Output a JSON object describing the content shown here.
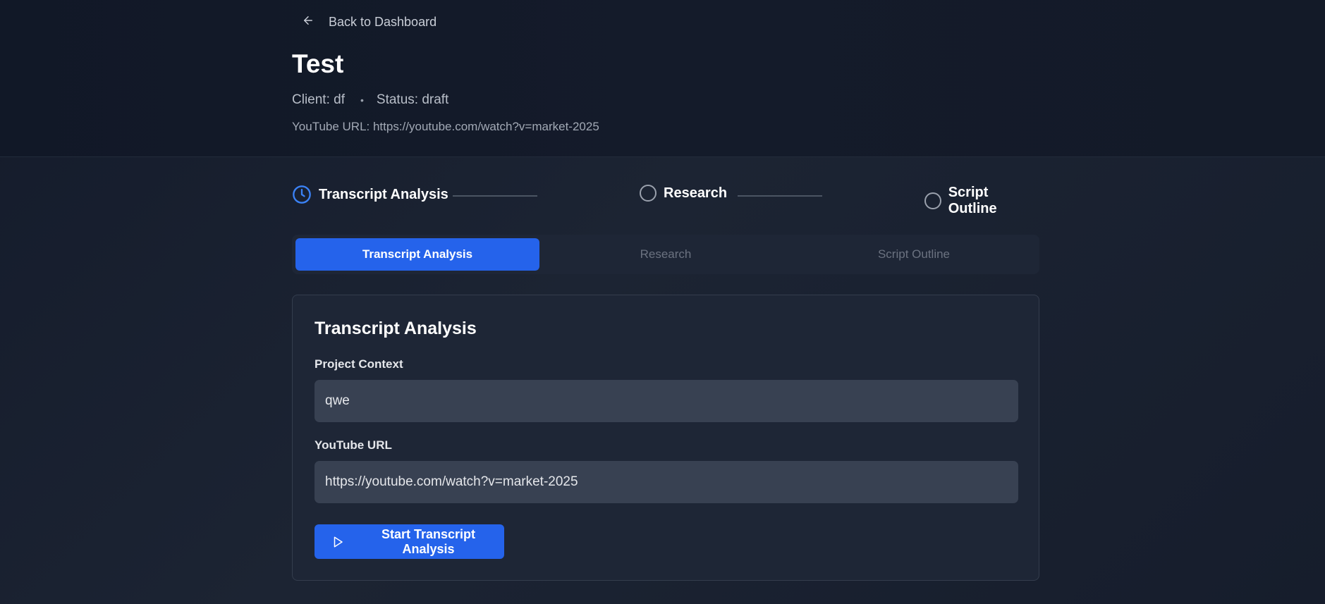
{
  "header": {
    "back_label": "Back to Dashboard",
    "title": "Test",
    "client": "Client: df",
    "separator": "•",
    "status": "Status: draft",
    "youtube_url": "YouTube URL: https://youtube.com/watch?v=market-2025"
  },
  "stepper": {
    "steps": [
      {
        "label": "Transcript Analysis",
        "icon": "clock-icon",
        "state": "current"
      },
      {
        "label": "Research",
        "icon": "circle-icon",
        "state": "pending"
      },
      {
        "label": "Script Outline",
        "icon": "circle-icon",
        "state": "pending"
      }
    ]
  },
  "tabs": [
    {
      "label": "Transcript Analysis",
      "active": true
    },
    {
      "label": "Research",
      "active": false
    },
    {
      "label": "Script Outline",
      "active": false
    }
  ],
  "card": {
    "title": "Transcript Analysis",
    "context_label": "Project Context",
    "context_value": "qwe",
    "url_label": "YouTube URL",
    "url_value": "https://youtube.com/watch?v=market-2025",
    "start_button": "Start Transcript Analysis"
  },
  "colors": {
    "accent": "#2563eb",
    "background": "#161d2c",
    "card": "#1e2636",
    "input": "#384152"
  }
}
